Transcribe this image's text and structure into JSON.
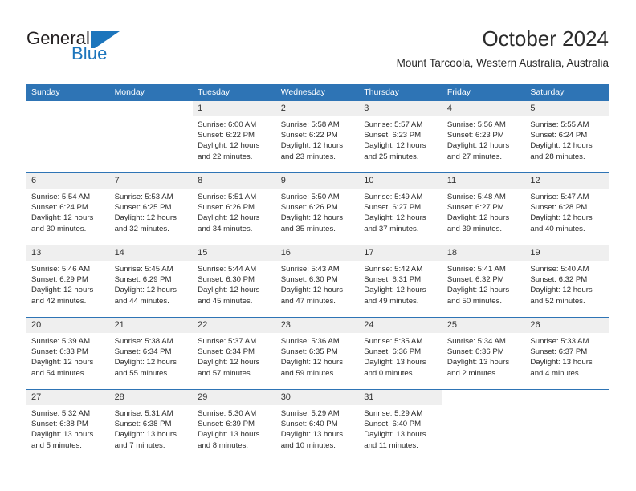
{
  "brand": {
    "name_top": "General",
    "name_bottom": "Blue",
    "mark": "triangle-logo"
  },
  "header": {
    "title": "October 2024",
    "subtitle": "Mount Tarcoola, Western Australia, Australia"
  },
  "colors": {
    "header_blue": "#2e74b5",
    "brand_blue": "#1c75bc",
    "daynum_background": "#efefef",
    "text": "#2b2b2b"
  },
  "weekday_headers": [
    "Sunday",
    "Monday",
    "Tuesday",
    "Wednesday",
    "Thursday",
    "Friday",
    "Saturday"
  ],
  "weeks": [
    [
      {
        "day": "",
        "lines": [],
        "blank": true
      },
      {
        "day": "",
        "lines": [],
        "blank": true
      },
      {
        "day": "1",
        "lines": [
          "Sunrise: 6:00 AM",
          "Sunset: 6:22 PM",
          "Daylight: 12 hours",
          "and 22 minutes."
        ]
      },
      {
        "day": "2",
        "lines": [
          "Sunrise: 5:58 AM",
          "Sunset: 6:22 PM",
          "Daylight: 12 hours",
          "and 23 minutes."
        ]
      },
      {
        "day": "3",
        "lines": [
          "Sunrise: 5:57 AM",
          "Sunset: 6:23 PM",
          "Daylight: 12 hours",
          "and 25 minutes."
        ]
      },
      {
        "day": "4",
        "lines": [
          "Sunrise: 5:56 AM",
          "Sunset: 6:23 PM",
          "Daylight: 12 hours",
          "and 27 minutes."
        ]
      },
      {
        "day": "5",
        "lines": [
          "Sunrise: 5:55 AM",
          "Sunset: 6:24 PM",
          "Daylight: 12 hours",
          "and 28 minutes."
        ]
      }
    ],
    [
      {
        "day": "6",
        "lines": [
          "Sunrise: 5:54 AM",
          "Sunset: 6:24 PM",
          "Daylight: 12 hours",
          "and 30 minutes."
        ]
      },
      {
        "day": "7",
        "lines": [
          "Sunrise: 5:53 AM",
          "Sunset: 6:25 PM",
          "Daylight: 12 hours",
          "and 32 minutes."
        ]
      },
      {
        "day": "8",
        "lines": [
          "Sunrise: 5:51 AM",
          "Sunset: 6:26 PM",
          "Daylight: 12 hours",
          "and 34 minutes."
        ]
      },
      {
        "day": "9",
        "lines": [
          "Sunrise: 5:50 AM",
          "Sunset: 6:26 PM",
          "Daylight: 12 hours",
          "and 35 minutes."
        ]
      },
      {
        "day": "10",
        "lines": [
          "Sunrise: 5:49 AM",
          "Sunset: 6:27 PM",
          "Daylight: 12 hours",
          "and 37 minutes."
        ]
      },
      {
        "day": "11",
        "lines": [
          "Sunrise: 5:48 AM",
          "Sunset: 6:27 PM",
          "Daylight: 12 hours",
          "and 39 minutes."
        ]
      },
      {
        "day": "12",
        "lines": [
          "Sunrise: 5:47 AM",
          "Sunset: 6:28 PM",
          "Daylight: 12 hours",
          "and 40 minutes."
        ]
      }
    ],
    [
      {
        "day": "13",
        "lines": [
          "Sunrise: 5:46 AM",
          "Sunset: 6:29 PM",
          "Daylight: 12 hours",
          "and 42 minutes."
        ]
      },
      {
        "day": "14",
        "lines": [
          "Sunrise: 5:45 AM",
          "Sunset: 6:29 PM",
          "Daylight: 12 hours",
          "and 44 minutes."
        ]
      },
      {
        "day": "15",
        "lines": [
          "Sunrise: 5:44 AM",
          "Sunset: 6:30 PM",
          "Daylight: 12 hours",
          "and 45 minutes."
        ]
      },
      {
        "day": "16",
        "lines": [
          "Sunrise: 5:43 AM",
          "Sunset: 6:30 PM",
          "Daylight: 12 hours",
          "and 47 minutes."
        ]
      },
      {
        "day": "17",
        "lines": [
          "Sunrise: 5:42 AM",
          "Sunset: 6:31 PM",
          "Daylight: 12 hours",
          "and 49 minutes."
        ]
      },
      {
        "day": "18",
        "lines": [
          "Sunrise: 5:41 AM",
          "Sunset: 6:32 PM",
          "Daylight: 12 hours",
          "and 50 minutes."
        ]
      },
      {
        "day": "19",
        "lines": [
          "Sunrise: 5:40 AM",
          "Sunset: 6:32 PM",
          "Daylight: 12 hours",
          "and 52 minutes."
        ]
      }
    ],
    [
      {
        "day": "20",
        "lines": [
          "Sunrise: 5:39 AM",
          "Sunset: 6:33 PM",
          "Daylight: 12 hours",
          "and 54 minutes."
        ]
      },
      {
        "day": "21",
        "lines": [
          "Sunrise: 5:38 AM",
          "Sunset: 6:34 PM",
          "Daylight: 12 hours",
          "and 55 minutes."
        ]
      },
      {
        "day": "22",
        "lines": [
          "Sunrise: 5:37 AM",
          "Sunset: 6:34 PM",
          "Daylight: 12 hours",
          "and 57 minutes."
        ]
      },
      {
        "day": "23",
        "lines": [
          "Sunrise: 5:36 AM",
          "Sunset: 6:35 PM",
          "Daylight: 12 hours",
          "and 59 minutes."
        ]
      },
      {
        "day": "24",
        "lines": [
          "Sunrise: 5:35 AM",
          "Sunset: 6:36 PM",
          "Daylight: 13 hours",
          "and 0 minutes."
        ]
      },
      {
        "day": "25",
        "lines": [
          "Sunrise: 5:34 AM",
          "Sunset: 6:36 PM",
          "Daylight: 13 hours",
          "and 2 minutes."
        ]
      },
      {
        "day": "26",
        "lines": [
          "Sunrise: 5:33 AM",
          "Sunset: 6:37 PM",
          "Daylight: 13 hours",
          "and 4 minutes."
        ]
      }
    ],
    [
      {
        "day": "27",
        "lines": [
          "Sunrise: 5:32 AM",
          "Sunset: 6:38 PM",
          "Daylight: 13 hours",
          "and 5 minutes."
        ]
      },
      {
        "day": "28",
        "lines": [
          "Sunrise: 5:31 AM",
          "Sunset: 6:38 PM",
          "Daylight: 13 hours",
          "and 7 minutes."
        ]
      },
      {
        "day": "29",
        "lines": [
          "Sunrise: 5:30 AM",
          "Sunset: 6:39 PM",
          "Daylight: 13 hours",
          "and 8 minutes."
        ]
      },
      {
        "day": "30",
        "lines": [
          "Sunrise: 5:29 AM",
          "Sunset: 6:40 PM",
          "Daylight: 13 hours",
          "and 10 minutes."
        ]
      },
      {
        "day": "31",
        "lines": [
          "Sunrise: 5:29 AM",
          "Sunset: 6:40 PM",
          "Daylight: 13 hours",
          "and 11 minutes."
        ]
      },
      {
        "day": "",
        "lines": [],
        "blank": true
      },
      {
        "day": "",
        "lines": [],
        "blank": true
      }
    ]
  ]
}
